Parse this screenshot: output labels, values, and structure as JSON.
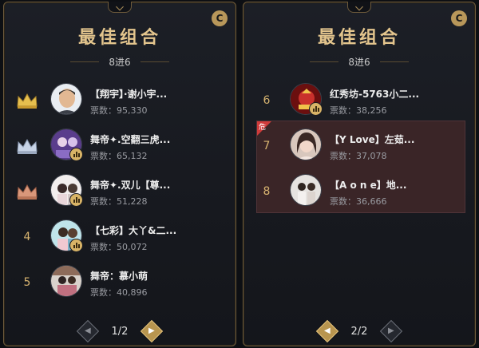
{
  "left": {
    "title": "最佳组合",
    "subtitle": "8进6",
    "rows": [
      {
        "rank": "",
        "name": "【翔宇】·谢小宇...",
        "votes": "票数：95,330"
      },
      {
        "rank": "",
        "name": "舞帝✦.空翻三虎...",
        "votes": "票数：65,132"
      },
      {
        "rank": "",
        "name": "舞帝✦.双儿【尊...",
        "votes": "票数：51,228"
      },
      {
        "rank": "4",
        "name": "【七彩】大丫&二...",
        "votes": "票数：50,072"
      },
      {
        "rank": "5",
        "name": "舞帝：慕小萌",
        "votes": "票数：40,896"
      }
    ],
    "page": "1/2"
  },
  "right": {
    "title": "最佳组合",
    "subtitle": "8进6",
    "rows": [
      {
        "rank": "6",
        "name": "红秀坊-5763小二...",
        "votes": "票数：38,256"
      },
      {
        "rank": "7",
        "name": "【Y Love】左茹...",
        "votes": "票数：37,078"
      },
      {
        "rank": "8",
        "name": "【A o n e】地...",
        "votes": "票数：36,666"
      }
    ],
    "danger_tag": "危",
    "page": "2/2"
  },
  "icons": {
    "refresh": "refresh-c-icon",
    "crown_gold": "gold-crown-icon",
    "crown_silver": "silver-crown-icon",
    "crown_bronze": "bronze-crown-icon",
    "badge": "audio-level-badge-icon",
    "prev": "chevron-left-icon",
    "next": "chevron-right-icon"
  },
  "colors": {
    "accent_gold": "#e3c58d",
    "danger": "#cf3b3b",
    "danger_bg": "#3a2527"
  }
}
